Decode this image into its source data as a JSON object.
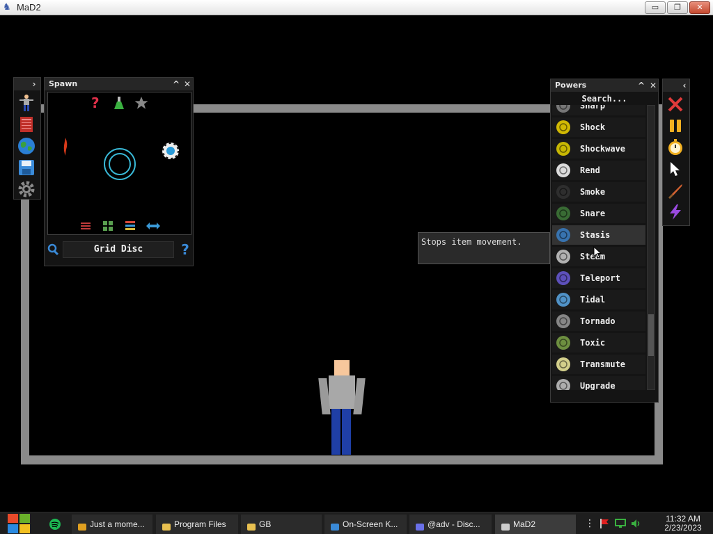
{
  "window": {
    "title": "MaD2",
    "minimize": "▭",
    "maximize": "❐",
    "close": "✕"
  },
  "spawn_panel": {
    "title": "Spawn",
    "item_name": "Grid Disc",
    "help_glyph": "?",
    "collapse_glyph": "^",
    "close_glyph": "✕",
    "expand_glyph": "›",
    "question_glyph": "?"
  },
  "powers_panel": {
    "title": "Powers",
    "search_placeholder": "Search...",
    "collapse_glyph": "^",
    "close_glyph": "✕",
    "back_glyph": "‹",
    "items": [
      {
        "label": "Sharp",
        "icon": "sharp-icon",
        "color": "#888888"
      },
      {
        "label": "Shock",
        "icon": "shock-icon",
        "color": "#f2d600"
      },
      {
        "label": "Shockwave",
        "icon": "shockwave-icon",
        "color": "#e6d300"
      },
      {
        "label": "Rend",
        "icon": "rend-icon",
        "color": "#ffffff"
      },
      {
        "label": "Smoke",
        "icon": "smoke-icon",
        "color": "#333333"
      },
      {
        "label": "Snare",
        "icon": "snare-icon",
        "color": "#3f7a3a"
      },
      {
        "label": "Stasis",
        "icon": "stasis-icon",
        "color": "#3a7fc6"
      },
      {
        "label": "Steam",
        "icon": "steam-icon",
        "color": "#cccccc"
      },
      {
        "label": "Teleport",
        "icon": "teleport-icon",
        "color": "#6a5ad8"
      },
      {
        "label": "Tidal",
        "icon": "tidal-icon",
        "color": "#5aa8e6"
      },
      {
        "label": "Tornado",
        "icon": "tornado-icon",
        "color": "#9a9a9a"
      },
      {
        "label": "Toxic",
        "icon": "toxic-icon",
        "color": "#7da548"
      },
      {
        "label": "Transmute",
        "icon": "transmute-icon",
        "color": "#f5f0a0"
      },
      {
        "label": "Upgrade",
        "icon": "upgrade-icon",
        "color": "#c8c8c8"
      }
    ],
    "hovered": "Stasis"
  },
  "tooltip": {
    "text": "Stops item movement."
  },
  "taskbar": {
    "tasks": [
      {
        "label": "Just a mome...",
        "icon": "chrome-icon"
      },
      {
        "label": "Program Files",
        "icon": "folder-icon"
      },
      {
        "label": "GB",
        "icon": "folder-icon"
      },
      {
        "label": "On-Screen K...",
        "icon": "keyboard-icon"
      },
      {
        "label": "@adv - Disc...",
        "icon": "discord-icon"
      },
      {
        "label": "MaD2",
        "icon": "mad2-icon"
      }
    ],
    "time": "11:32 AM",
    "date": "2/23/2023"
  },
  "colors": {
    "accent_cyan": "#39b8d6",
    "wall": "#8a8a8a",
    "panel_bg": "#141414"
  }
}
